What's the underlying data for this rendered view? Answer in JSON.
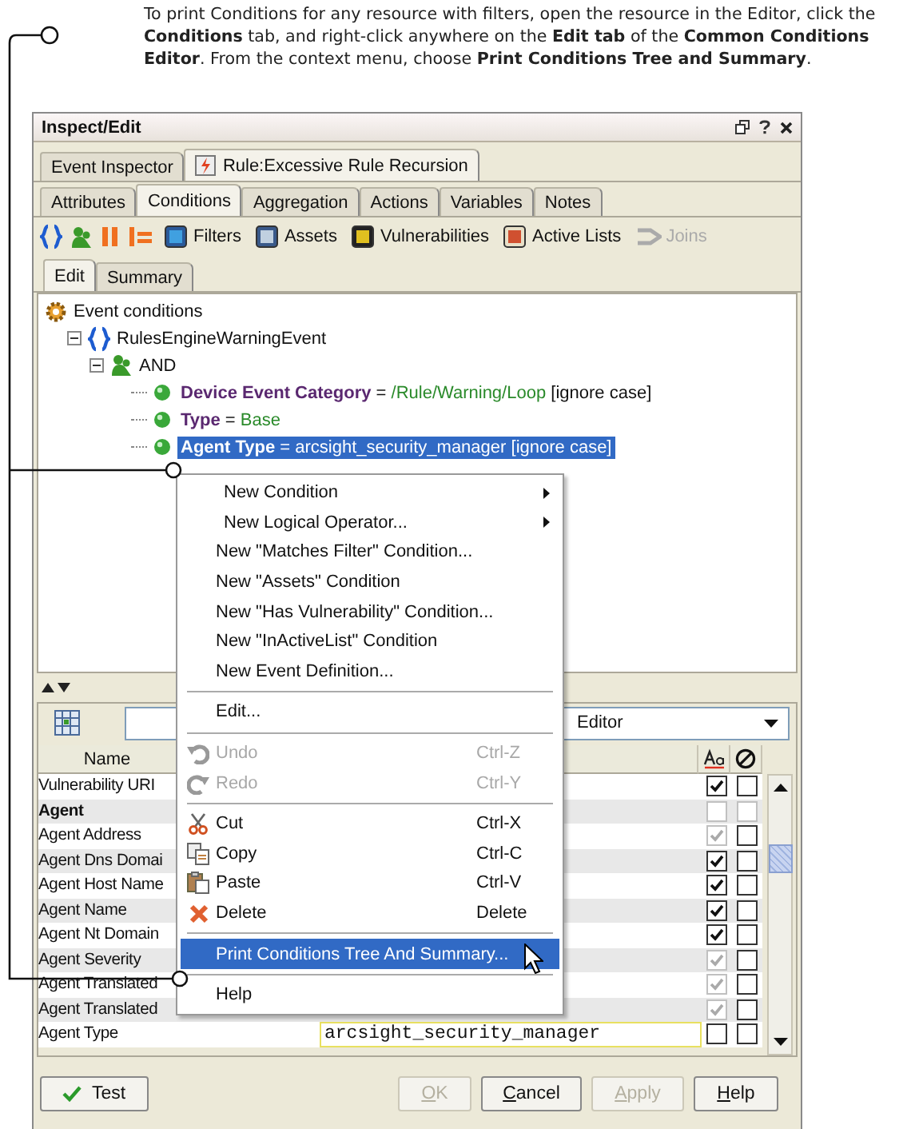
{
  "callout": {
    "text": "To print Conditions for any resource with filters, open the resource in the Editor, click the **Conditions** tab, and right-click anywhere on the **Edit tab** of the **Common Conditions Editor**. From the context menu, choose **Print Conditions Tree and Summary**."
  },
  "window": {
    "title": "Inspect/Edit"
  },
  "editor_tabs": [
    {
      "label": "Event Inspector",
      "selected": false,
      "kind": "plain"
    },
    {
      "label": "Rule:Excessive Rule Recursion",
      "selected": true,
      "kind": "rule"
    }
  ],
  "resource_tabs": [
    {
      "label": "Attributes",
      "selected": false
    },
    {
      "label": "Conditions",
      "selected": true
    },
    {
      "label": "Aggregation",
      "selected": false
    },
    {
      "label": "Actions",
      "selected": false
    },
    {
      "label": "Variables",
      "selected": false
    },
    {
      "label": "Notes",
      "selected": false
    }
  ],
  "toolbar": [
    {
      "label": "Filters",
      "disabled": false
    },
    {
      "label": "Assets",
      "disabled": false
    },
    {
      "label": "Vulnerabilities",
      "disabled": false
    },
    {
      "label": "Active Lists",
      "disabled": false
    },
    {
      "label": "Joins",
      "disabled": true
    }
  ],
  "view_tabs": [
    {
      "label": "Edit",
      "selected": true
    },
    {
      "label": "Summary",
      "selected": false
    }
  ],
  "tree": {
    "label": "Event conditions",
    "kind": "root",
    "children": [
      {
        "label": "RulesEngineWarningEvent",
        "kind": "event",
        "expanded": true,
        "children": [
          {
            "label": "AND",
            "kind": "and",
            "expanded": true,
            "children": [
              {
                "kind": "condition",
                "field": "Device Event Category",
                "operator": "=",
                "value": "/Rule/Warning/Loop",
                "suffix": "[ignore case]",
                "selected": false
              },
              {
                "kind": "condition",
                "field": "Type",
                "operator": "=",
                "value": "Base",
                "selected": false
              },
              {
                "kind": "condition",
                "field": "Agent Type",
                "operator": "=",
                "value": "arcsight_security_manager",
                "suffix": "[ignore case]",
                "selected": true
              }
            ]
          }
        ]
      }
    ]
  },
  "field_editor": {
    "dropdown": "Editor"
  },
  "table": {
    "columns": [
      "Name"
    ],
    "rows": [
      {
        "name": "Vulnerability URI",
        "kind": "field",
        "checks": [
          {
            "checked": true,
            "disabled": false
          },
          {
            "checked": false,
            "disabled": false
          }
        ]
      },
      {
        "name": "Agent",
        "kind": "group",
        "checks": [
          {
            "checked": false,
            "disabled": true
          },
          {
            "checked": false,
            "disabled": true
          }
        ]
      },
      {
        "name": "Agent Address",
        "kind": "field",
        "checks": [
          {
            "checked": true,
            "disabled": true
          },
          {
            "checked": false,
            "disabled": false
          }
        ]
      },
      {
        "name": "Agent Dns Domai",
        "kind": "field",
        "checks": [
          {
            "checked": true,
            "disabled": false
          },
          {
            "checked": false,
            "disabled": false
          }
        ]
      },
      {
        "name": "Agent Host Name",
        "kind": "field",
        "checks": [
          {
            "checked": true,
            "disabled": false
          },
          {
            "checked": false,
            "disabled": false
          }
        ]
      },
      {
        "name": "Agent Name",
        "kind": "field",
        "checks": [
          {
            "checked": true,
            "disabled": false
          },
          {
            "checked": false,
            "disabled": false
          }
        ]
      },
      {
        "name": "Agent Nt Domain",
        "kind": "field",
        "checks": [
          {
            "checked": true,
            "disabled": false
          },
          {
            "checked": false,
            "disabled": false
          }
        ]
      },
      {
        "name": "Agent Severity",
        "kind": "field",
        "checks": [
          {
            "checked": true,
            "disabled": true
          },
          {
            "checked": false,
            "disabled": false
          }
        ]
      },
      {
        "name": "Agent Translated",
        "kind": "field",
        "checks": [
          {
            "checked": true,
            "disabled": true
          },
          {
            "checked": false,
            "disabled": false
          }
        ]
      },
      {
        "name": "Agent Translated",
        "kind": "field",
        "checks": [
          {
            "checked": true,
            "disabled": true
          },
          {
            "checked": false,
            "disabled": false
          }
        ]
      },
      {
        "name": "Agent Type",
        "kind": "field",
        "value": "arcsight_security_manager",
        "checks": [
          {
            "checked": false,
            "disabled": false
          },
          {
            "checked": false,
            "disabled": false
          }
        ]
      }
    ]
  },
  "context_menu": [
    {
      "kind": "submenu",
      "label": "New Condition",
      "disabled": false,
      "selected": false
    },
    {
      "kind": "submenu",
      "label": "New Logical Operator...",
      "disabled": false,
      "selected": false
    },
    {
      "kind": "item",
      "label": "New \"Matches Filter\" Condition...",
      "disabled": false,
      "selected": false
    },
    {
      "kind": "item",
      "label": "New \"Assets\" Condition",
      "disabled": false,
      "selected": false
    },
    {
      "kind": "item",
      "label": "New \"Has Vulnerability\" Condition...",
      "disabled": false,
      "selected": false
    },
    {
      "kind": "item",
      "label": "New \"InActiveList\" Condition",
      "disabled": false,
      "selected": false
    },
    {
      "kind": "item",
      "label": "New Event Definition...",
      "disabled": false,
      "selected": false
    },
    {
      "kind": "separator"
    },
    {
      "kind": "item",
      "label": "Edit...",
      "disabled": false,
      "selected": false
    },
    {
      "kind": "separator"
    },
    {
      "kind": "undo",
      "label": "Undo",
      "shortcut": "Ctrl-Z",
      "disabled": true,
      "selected": false
    },
    {
      "kind": "redo",
      "label": "Redo",
      "shortcut": "Ctrl-Y",
      "disabled": true,
      "selected": false
    },
    {
      "kind": "separator"
    },
    {
      "kind": "cut",
      "label": "Cut",
      "shortcut": "Ctrl-X",
      "disabled": false,
      "selected": false
    },
    {
      "kind": "copy",
      "label": "Copy",
      "shortcut": "Ctrl-C",
      "disabled": false,
      "selected": false
    },
    {
      "kind": "paste",
      "label": "Paste",
      "shortcut": "Ctrl-V",
      "disabled": false,
      "selected": false
    },
    {
      "kind": "delete",
      "label": "Delete",
      "shortcut": "Delete",
      "disabled": false,
      "selected": false
    },
    {
      "kind": "separator"
    },
    {
      "kind": "item",
      "label": "Print Conditions Tree And Summary...",
      "disabled": false,
      "selected": true
    },
    {
      "kind": "separator"
    },
    {
      "kind": "item",
      "label": "Help",
      "disabled": false,
      "selected": false
    }
  ],
  "buttons": [
    {
      "label": "Test",
      "kind": "test",
      "disabled": false
    },
    {
      "label": "OK",
      "kind": "plain",
      "disabled": true
    },
    {
      "label": "Cancel",
      "kind": "plain",
      "disabled": false
    },
    {
      "label": "Apply",
      "kind": "plain",
      "disabled": true
    },
    {
      "label": "Help",
      "kind": "plain",
      "disabled": false
    }
  ]
}
